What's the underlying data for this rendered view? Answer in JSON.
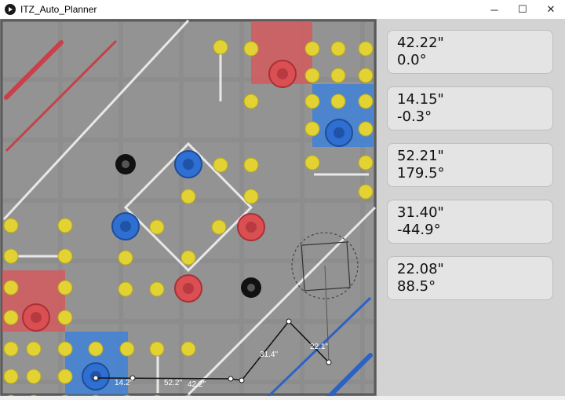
{
  "window": {
    "title": "ITZ_Auto_Planner",
    "controls": [
      "─",
      "☐",
      "✕"
    ]
  },
  "colors": {
    "field": "#8c8c8c",
    "red": "#d94f52",
    "blue": "#2f6fd1",
    "cone": "#e3d234",
    "panel": "#d3d3d3"
  },
  "path": {
    "segment_labels": [
      "14.2\"",
      "52.2\"",
      "42.2\"",
      "31.4\"",
      "22.1\""
    ]
  },
  "panel": {
    "cards": [
      {
        "distance": "42.22\"",
        "angle": "0.0°"
      },
      {
        "distance": "14.15\"",
        "angle": "-0.3°"
      },
      {
        "distance": "52.21\"",
        "angle": "179.5°"
      },
      {
        "distance": "31.40\"",
        "angle": "-44.9°"
      },
      {
        "distance": "22.08\"",
        "angle": "88.5°"
      }
    ]
  }
}
